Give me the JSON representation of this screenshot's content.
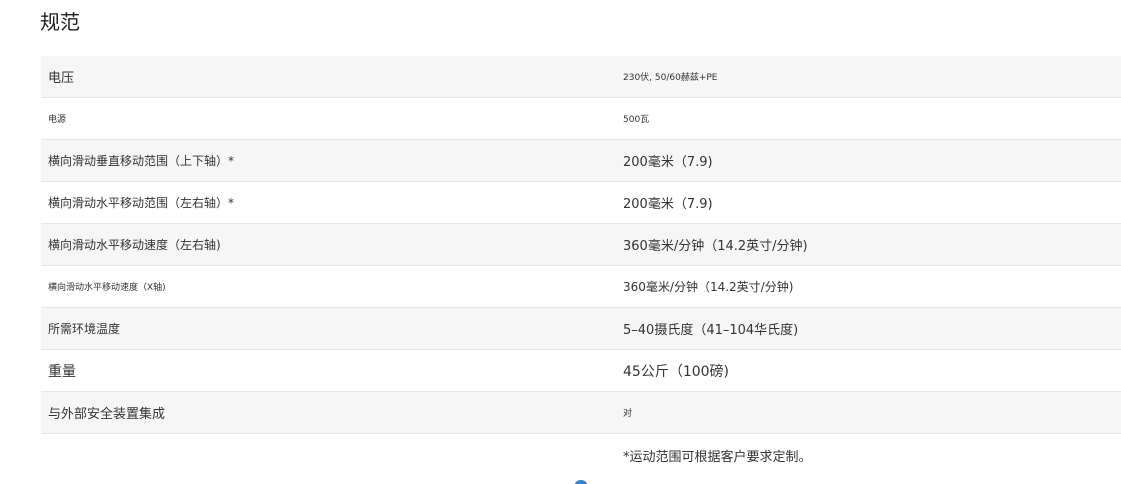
{
  "title": "规范",
  "specs": [
    {
      "label": "电压",
      "value": "230伏, 50/60赫兹+PE"
    },
    {
      "label": "电源",
      "value": "500瓦"
    },
    {
      "label": "横向滑动垂直移动范围（上下轴）*",
      "value": "200毫米（7.9)"
    },
    {
      "label": "横向滑动水平移动范围（左右轴）*",
      "value": "200毫米（7.9)"
    },
    {
      "label": "横向滑动水平移动速度（左右轴)",
      "value": "360毫米/分钟（14.2英寸/分钟)"
    },
    {
      "label": "横向滑动水平移动速度（X轴)",
      "value": "360毫米/分钟（14.2英寸/分钟)"
    },
    {
      "label": "所需环境温度",
      "value": "5–40摄氏度（41–104华氏度)"
    },
    {
      "label": "重量",
      "value": "45公斤（100磅)"
    },
    {
      "label": "与外部安全装置集成",
      "value": "对"
    }
  ],
  "note": "*运动范围可根据客户要求定制。",
  "colors": {
    "row_shade": "#f6f6f6",
    "divider": "#e6e6e6",
    "accent": "#2a86e0"
  }
}
